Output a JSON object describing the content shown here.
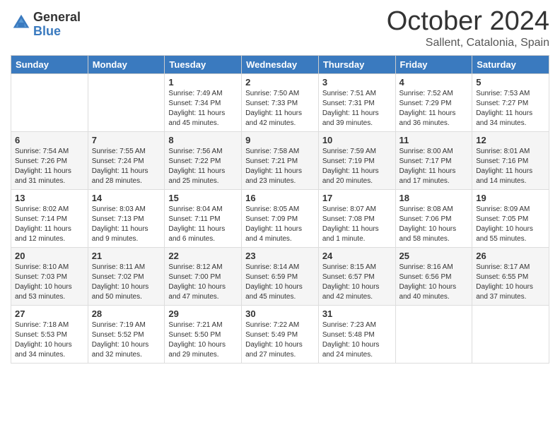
{
  "logo": {
    "general": "General",
    "blue": "Blue"
  },
  "header": {
    "month": "October 2024",
    "location": "Sallent, Catalonia, Spain"
  },
  "weekdays": [
    "Sunday",
    "Monday",
    "Tuesday",
    "Wednesday",
    "Thursday",
    "Friday",
    "Saturday"
  ],
  "weeks": [
    [
      {
        "day": "",
        "info": ""
      },
      {
        "day": "",
        "info": ""
      },
      {
        "day": "1",
        "info": "Sunrise: 7:49 AM\nSunset: 7:34 PM\nDaylight: 11 hours and 45 minutes."
      },
      {
        "day": "2",
        "info": "Sunrise: 7:50 AM\nSunset: 7:33 PM\nDaylight: 11 hours and 42 minutes."
      },
      {
        "day": "3",
        "info": "Sunrise: 7:51 AM\nSunset: 7:31 PM\nDaylight: 11 hours and 39 minutes."
      },
      {
        "day": "4",
        "info": "Sunrise: 7:52 AM\nSunset: 7:29 PM\nDaylight: 11 hours and 36 minutes."
      },
      {
        "day": "5",
        "info": "Sunrise: 7:53 AM\nSunset: 7:27 PM\nDaylight: 11 hours and 34 minutes."
      }
    ],
    [
      {
        "day": "6",
        "info": "Sunrise: 7:54 AM\nSunset: 7:26 PM\nDaylight: 11 hours and 31 minutes."
      },
      {
        "day": "7",
        "info": "Sunrise: 7:55 AM\nSunset: 7:24 PM\nDaylight: 11 hours and 28 minutes."
      },
      {
        "day": "8",
        "info": "Sunrise: 7:56 AM\nSunset: 7:22 PM\nDaylight: 11 hours and 25 minutes."
      },
      {
        "day": "9",
        "info": "Sunrise: 7:58 AM\nSunset: 7:21 PM\nDaylight: 11 hours and 23 minutes."
      },
      {
        "day": "10",
        "info": "Sunrise: 7:59 AM\nSunset: 7:19 PM\nDaylight: 11 hours and 20 minutes."
      },
      {
        "day": "11",
        "info": "Sunrise: 8:00 AM\nSunset: 7:17 PM\nDaylight: 11 hours and 17 minutes."
      },
      {
        "day": "12",
        "info": "Sunrise: 8:01 AM\nSunset: 7:16 PM\nDaylight: 11 hours and 14 minutes."
      }
    ],
    [
      {
        "day": "13",
        "info": "Sunrise: 8:02 AM\nSunset: 7:14 PM\nDaylight: 11 hours and 12 minutes."
      },
      {
        "day": "14",
        "info": "Sunrise: 8:03 AM\nSunset: 7:13 PM\nDaylight: 11 hours and 9 minutes."
      },
      {
        "day": "15",
        "info": "Sunrise: 8:04 AM\nSunset: 7:11 PM\nDaylight: 11 hours and 6 minutes."
      },
      {
        "day": "16",
        "info": "Sunrise: 8:05 AM\nSunset: 7:09 PM\nDaylight: 11 hours and 4 minutes."
      },
      {
        "day": "17",
        "info": "Sunrise: 8:07 AM\nSunset: 7:08 PM\nDaylight: 11 hours and 1 minute."
      },
      {
        "day": "18",
        "info": "Sunrise: 8:08 AM\nSunset: 7:06 PM\nDaylight: 10 hours and 58 minutes."
      },
      {
        "day": "19",
        "info": "Sunrise: 8:09 AM\nSunset: 7:05 PM\nDaylight: 10 hours and 55 minutes."
      }
    ],
    [
      {
        "day": "20",
        "info": "Sunrise: 8:10 AM\nSunset: 7:03 PM\nDaylight: 10 hours and 53 minutes."
      },
      {
        "day": "21",
        "info": "Sunrise: 8:11 AM\nSunset: 7:02 PM\nDaylight: 10 hours and 50 minutes."
      },
      {
        "day": "22",
        "info": "Sunrise: 8:12 AM\nSunset: 7:00 PM\nDaylight: 10 hours and 47 minutes."
      },
      {
        "day": "23",
        "info": "Sunrise: 8:14 AM\nSunset: 6:59 PM\nDaylight: 10 hours and 45 minutes."
      },
      {
        "day": "24",
        "info": "Sunrise: 8:15 AM\nSunset: 6:57 PM\nDaylight: 10 hours and 42 minutes."
      },
      {
        "day": "25",
        "info": "Sunrise: 8:16 AM\nSunset: 6:56 PM\nDaylight: 10 hours and 40 minutes."
      },
      {
        "day": "26",
        "info": "Sunrise: 8:17 AM\nSunset: 6:55 PM\nDaylight: 10 hours and 37 minutes."
      }
    ],
    [
      {
        "day": "27",
        "info": "Sunrise: 7:18 AM\nSunset: 5:53 PM\nDaylight: 10 hours and 34 minutes."
      },
      {
        "day": "28",
        "info": "Sunrise: 7:19 AM\nSunset: 5:52 PM\nDaylight: 10 hours and 32 minutes."
      },
      {
        "day": "29",
        "info": "Sunrise: 7:21 AM\nSunset: 5:50 PM\nDaylight: 10 hours and 29 minutes."
      },
      {
        "day": "30",
        "info": "Sunrise: 7:22 AM\nSunset: 5:49 PM\nDaylight: 10 hours and 27 minutes."
      },
      {
        "day": "31",
        "info": "Sunrise: 7:23 AM\nSunset: 5:48 PM\nDaylight: 10 hours and 24 minutes."
      },
      {
        "day": "",
        "info": ""
      },
      {
        "day": "",
        "info": ""
      }
    ]
  ]
}
